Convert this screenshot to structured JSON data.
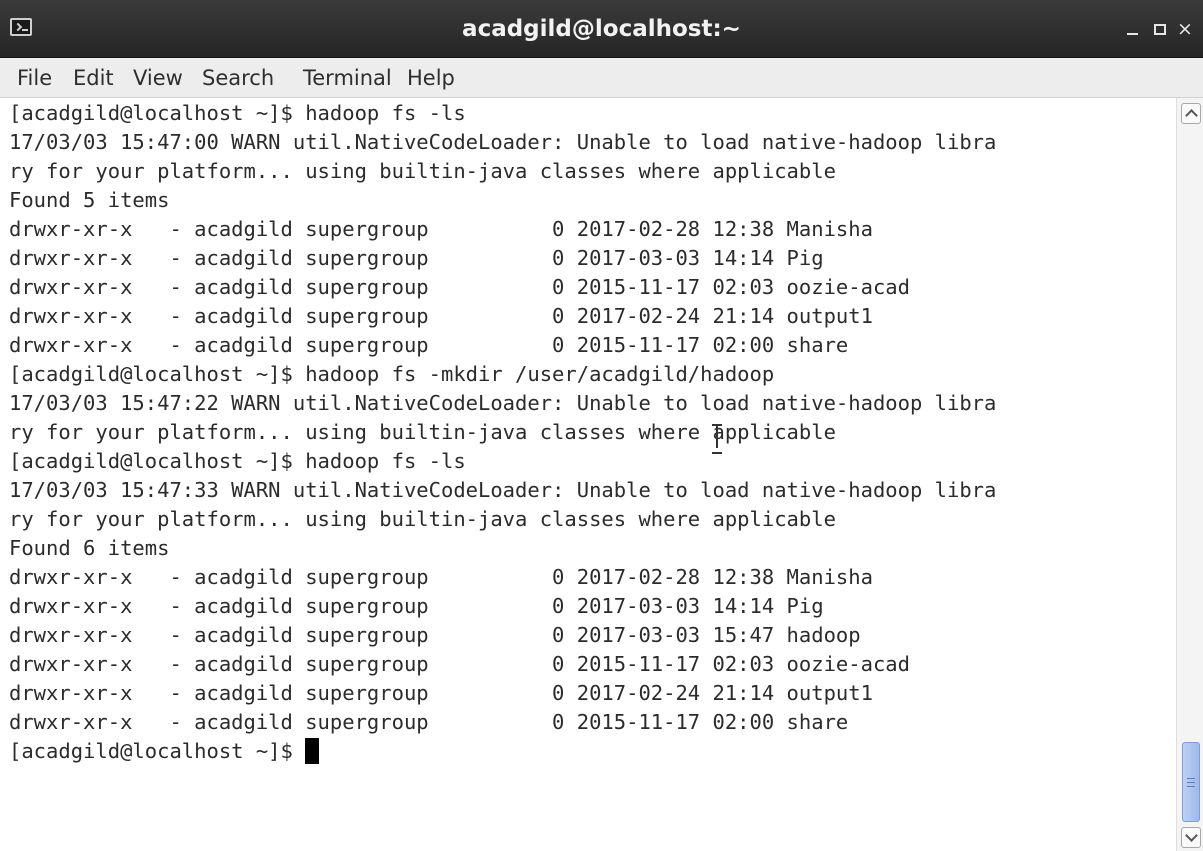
{
  "window": {
    "title": "acadgild@localhost:~",
    "controls": {
      "minimize": "minimize",
      "maximize": "maximize",
      "close": "×"
    }
  },
  "menu": [
    {
      "label": "File"
    },
    {
      "label": "Edit"
    },
    {
      "label": "View"
    },
    {
      "label": "Search"
    },
    {
      "label": "Terminal"
    },
    {
      "label": "Help"
    }
  ],
  "terminal": {
    "lines": [
      "[acadgild@localhost ~]$ hadoop fs -ls",
      "17/03/03 15:47:00 WARN util.NativeCodeLoader: Unable to load native-hadoop libra",
      "ry for your platform... using builtin-java classes where applicable",
      "Found 5 items",
      "drwxr-xr-x   - acadgild supergroup          0 2017-02-28 12:38 Manisha",
      "drwxr-xr-x   - acadgild supergroup          0 2017-03-03 14:14 Pig",
      "drwxr-xr-x   - acadgild supergroup          0 2015-11-17 02:03 oozie-acad",
      "drwxr-xr-x   - acadgild supergroup          0 2017-02-24 21:14 output1",
      "drwxr-xr-x   - acadgild supergroup          0 2015-11-17 02:00 share",
      "[acadgild@localhost ~]$ hadoop fs -mkdir /user/acadgild/hadoop",
      "17/03/03 15:47:22 WARN util.NativeCodeLoader: Unable to load native-hadoop libra",
      "ry for your platform... using builtin-java classes where applicable",
      "[acadgild@localhost ~]$ hadoop fs -ls",
      "17/03/03 15:47:33 WARN util.NativeCodeLoader: Unable to load native-hadoop libra",
      "ry for your platform... using builtin-java classes where applicable",
      "Found 6 items",
      "drwxr-xr-x   - acadgild supergroup          0 2017-02-28 12:38 Manisha",
      "drwxr-xr-x   - acadgild supergroup          0 2017-03-03 14:14 Pig",
      "drwxr-xr-x   - acadgild supergroup          0 2017-03-03 15:47 hadoop",
      "drwxr-xr-x   - acadgild supergroup          0 2015-11-17 02:03 oozie-acad",
      "drwxr-xr-x   - acadgild supergroup          0 2017-02-24 21:14 output1",
      "drwxr-xr-x   - acadgild supergroup          0 2015-11-17 02:00 share"
    ],
    "prompt": "[acadgild@localhost ~]$ "
  },
  "scrollbar": {
    "position": "bottom"
  },
  "icons": {
    "app": "terminal-icon",
    "pointer": "text-cursor-ibeam-icon"
  }
}
